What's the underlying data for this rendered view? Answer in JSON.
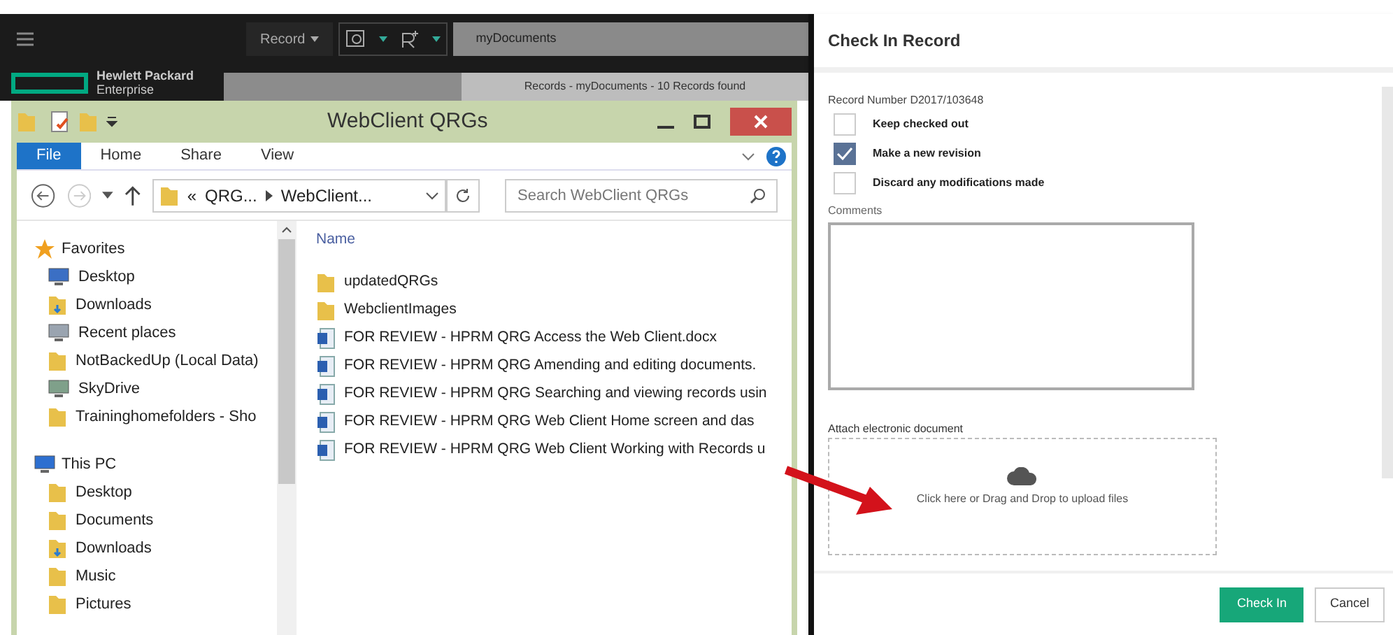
{
  "app_bar": {
    "record_menu": "Record",
    "search_value": "myDocuments",
    "brand": [
      "Hewlett Packard",
      "Enterprise"
    ],
    "results_header": "Records - myDocuments - 10 Records found"
  },
  "explorer": {
    "title": "WebClient QRGs",
    "ribbon_tabs": [
      {
        "label": "File",
        "selected": true
      },
      {
        "label": "Home",
        "selected": false
      },
      {
        "label": "Share",
        "selected": false
      },
      {
        "label": "View",
        "selected": false
      }
    ],
    "breadcrumb": [
      "«",
      "QRG...",
      "WebClient..."
    ],
    "search": {
      "placeholder": "Search WebClient QRGs"
    },
    "nav": [
      {
        "label": "Favorites",
        "kind": "star",
        "children": [
          {
            "label": "Desktop",
            "kind": "desktop"
          },
          {
            "label": "Downloads",
            "kind": "download"
          },
          {
            "label": "Recent places",
            "kind": "recent"
          },
          {
            "label": "NotBackedUp (Local Data)",
            "kind": "folder"
          },
          {
            "label": "SkyDrive",
            "kind": "drive"
          },
          {
            "label": "Traininghomefolders - Sho",
            "kind": "folder"
          }
        ]
      },
      {
        "label": "This PC",
        "kind": "pc",
        "children": [
          {
            "label": "Desktop",
            "kind": "folder"
          },
          {
            "label": "Documents",
            "kind": "folder"
          },
          {
            "label": "Downloads",
            "kind": "download"
          },
          {
            "label": "Music",
            "kind": "folder"
          },
          {
            "label": "Pictures",
            "kind": "folder"
          }
        ]
      }
    ],
    "column": "Name",
    "files": [
      {
        "name": "updatedQRGs",
        "kind": "folder"
      },
      {
        "name": "WebclientImages",
        "kind": "folder"
      },
      {
        "name": "FOR REVIEW - HPRM QRG Access the Web Client.docx",
        "kind": "doc"
      },
      {
        "name": "FOR REVIEW - HPRM QRG Amending and editing documents.",
        "kind": "doc"
      },
      {
        "name": "FOR REVIEW - HPRM QRG Searching and viewing records usin",
        "kind": "doc"
      },
      {
        "name": "FOR REVIEW - HPRM QRG Web Client Home screen and das",
        "kind": "doc"
      },
      {
        "name": "FOR REVIEW - HPRM QRG Web Client Working with Records u",
        "kind": "doc"
      }
    ]
  },
  "dialog": {
    "title": "Check In Record",
    "record_number": "Record Number D2017/103648",
    "options": [
      {
        "label": "Keep checked out",
        "checked": false
      },
      {
        "label": "Make a new revision",
        "checked": true
      },
      {
        "label": "Discard any modifications made",
        "checked": false
      }
    ],
    "comments_label": "Comments",
    "attach_label": "Attach electronic document",
    "drop_text": "Click here or Drag and Drop to upload files",
    "buttons": [
      {
        "label": "Check In",
        "kind": "primary"
      },
      {
        "label": "Cancel",
        "kind": "secondary"
      }
    ]
  }
}
